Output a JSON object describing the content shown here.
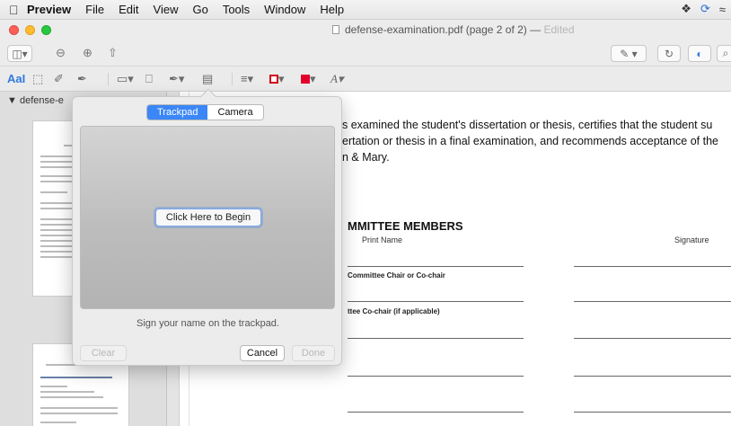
{
  "menubar": {
    "apple": "",
    "items": [
      "Preview",
      "File",
      "Edit",
      "View",
      "Go",
      "Tools",
      "Window",
      "Help"
    ]
  },
  "window": {
    "title": "defense-examination.pdf (page 2 of 2)",
    "separator": "—",
    "status": "Edited"
  },
  "sidebar": {
    "header": "defense-e"
  },
  "document": {
    "lines": [
      "s examined the student's dissertation or thesis, certifies that the student su",
      "ertation or thesis in a final examination, and recommends acceptance of the",
      "n & Mary."
    ],
    "heading": "MMITTEE MEMBERS",
    "columns": {
      "print_name": "Print Name",
      "signature": "Signature"
    },
    "roles": [
      "Committee Chair or Co-chair",
      "ttee Co-chair (if applicable)"
    ]
  },
  "signature_popover": {
    "tabs": {
      "trackpad": "Trackpad",
      "camera": "Camera"
    },
    "begin_button": "Click Here to Begin",
    "hint": "Sign your name on the trackpad.",
    "clear": "Clear",
    "cancel": "Cancel",
    "done": "Done"
  },
  "icons": {
    "menubar_right": [
      "dropbox-icon",
      "sync-icon",
      "wifi-icon"
    ],
    "toolbar": [
      "sidebar-toggle-icon",
      "zoom-out-icon",
      "zoom-in-icon",
      "share-icon",
      "pen-icon",
      "rotate-icon",
      "markup-icon"
    ],
    "markup": [
      "text-style-icon",
      "selection-icon",
      "sketch-icon",
      "draw-icon",
      "shapes-icon",
      "text-box-icon",
      "sign-icon",
      "note-icon",
      "line-style-icon",
      "border-color-icon",
      "fill-color-icon",
      "font-icon"
    ]
  },
  "colors": {
    "accent": "#3b87f7",
    "border_color": "#d0021b",
    "fill_color": "#e2002a"
  }
}
